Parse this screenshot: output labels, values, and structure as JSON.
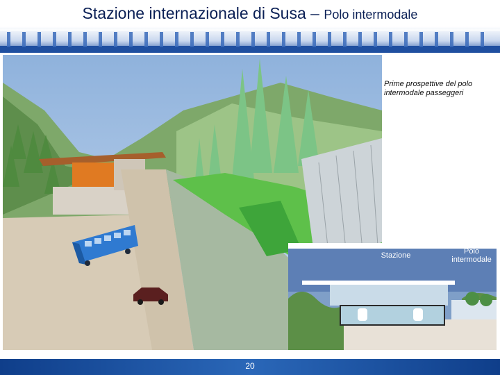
{
  "slide": {
    "title_main": "Stazione internazionale di Susa – ",
    "title_sub": "Polo intermodale",
    "caption": "Prime prospettive del polo intermodale passeggeri",
    "inset": {
      "label_station": "Stazione",
      "label_hub": "Polo intermodale"
    },
    "page_number": "20"
  },
  "colors": {
    "title": "#0a1f55",
    "header_band": "#1f4fa0",
    "footer_band": "#1f5aa8",
    "inset_sky": "#5d7fb5"
  }
}
